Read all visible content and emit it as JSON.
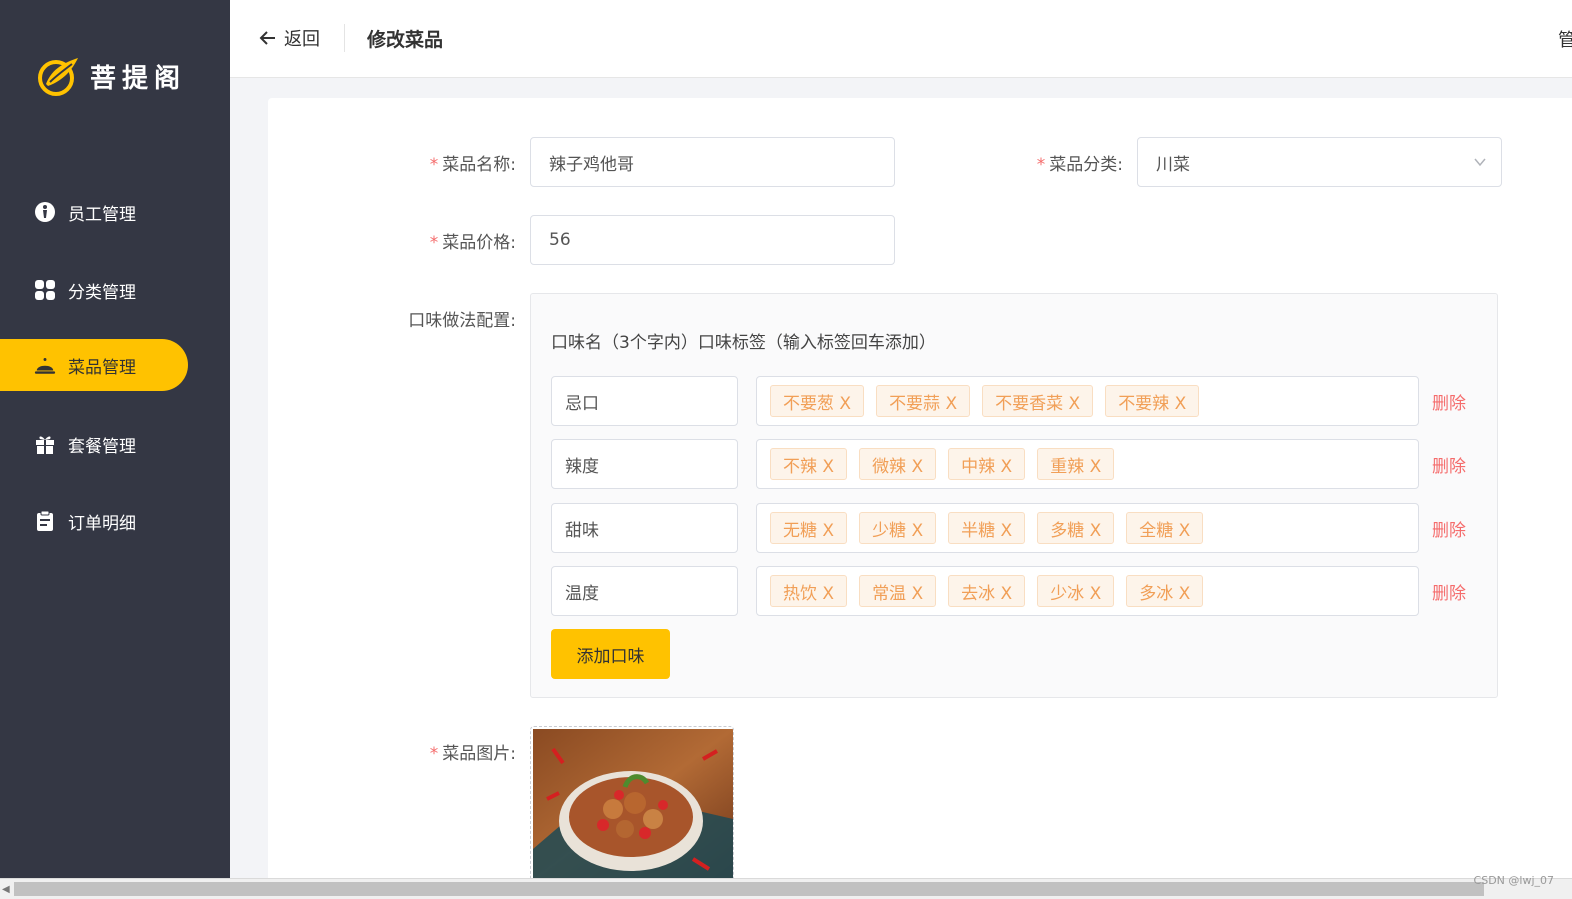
{
  "app": {
    "logo_text": "菩提阁"
  },
  "sidebar": {
    "items": [
      {
        "label": "员工管理",
        "icon": "employee-icon",
        "active": false
      },
      {
        "label": "分类管理",
        "icon": "category-grid-icon",
        "active": false
      },
      {
        "label": "菜品管理",
        "icon": "dish-cloche-icon",
        "active": true
      },
      {
        "label": "套餐管理",
        "icon": "gift-icon",
        "active": false
      },
      {
        "label": "订单明细",
        "icon": "clipboard-icon",
        "active": false
      }
    ]
  },
  "header": {
    "back_label": "返回",
    "title": "修改菜品",
    "right_text": "管"
  },
  "form": {
    "name_label": "菜品名称:",
    "name_value": "辣子鸡他哥",
    "category_label": "菜品分类:",
    "category_value": "川菜",
    "price_label": "菜品价格:",
    "price_value": "56",
    "flavor_label": "口味做法配置:",
    "flavor_header": "口味名（3个字内）口味标签（输入标签回车添加）",
    "flavors": [
      {
        "name": "忌口",
        "tags": [
          "不要葱 X",
          "不要蒜 X",
          "不要香菜 X",
          "不要辣 X"
        ]
      },
      {
        "name": "辣度",
        "tags": [
          "不辣 X",
          "微辣 X",
          "中辣 X",
          "重辣 X"
        ]
      },
      {
        "name": "甜味",
        "tags": [
          "无糖 X",
          "少糖 X",
          "半糖 X",
          "多糖 X",
          "全糖 X"
        ]
      },
      {
        "name": "温度",
        "tags": [
          "热饮 X",
          "常温 X",
          "去冰 X",
          "少冰 X",
          "多冰 X"
        ]
      }
    ],
    "delete_label": "删除",
    "add_flavor_label": "添加口味",
    "image_label": "菜品图片:"
  },
  "colors": {
    "accent": "#ffc200",
    "sidebar_bg": "#343744",
    "required": "#f56c6c",
    "tag_text": "#f19f57",
    "tag_bg": "#fdf4ea"
  },
  "watermark": "CSDN @lwj_07"
}
